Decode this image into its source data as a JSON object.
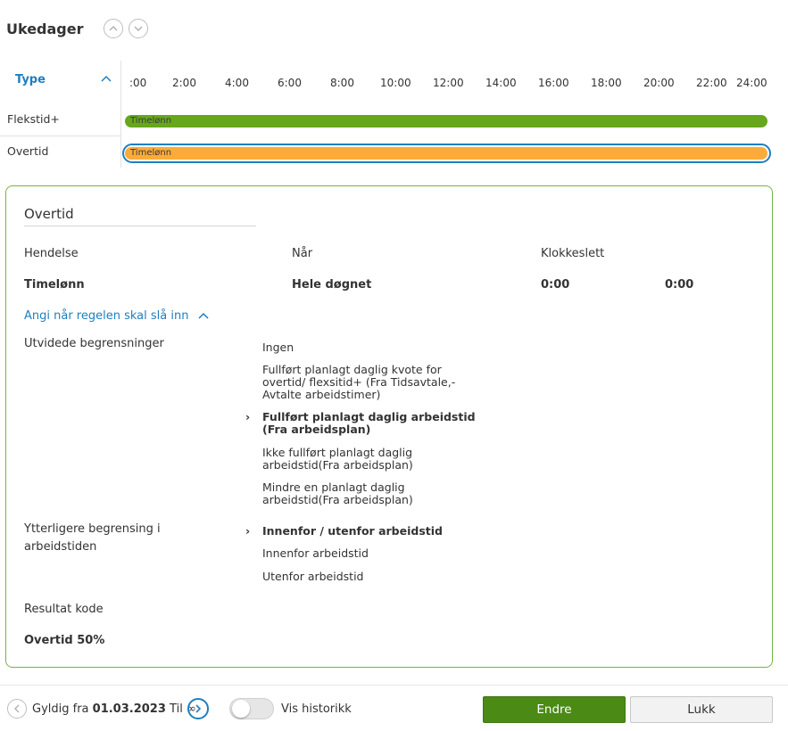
{
  "header": {
    "title": "Ukedager",
    "up_icon": "chevron-up-icon",
    "down_icon": "chevron-down-icon"
  },
  "timeline": {
    "type_label": "Type",
    "ticks": [
      ":00",
      "2:00",
      "4:00",
      "6:00",
      "8:00",
      "10:00",
      "12:00",
      "14:00",
      "16:00",
      "18:00",
      "20:00",
      "22:00",
      "24:00"
    ],
    "rows": [
      {
        "label": "Flekstid+",
        "bar_label": "Timelønn",
        "color": "#66a71c"
      },
      {
        "label": "Overtid",
        "bar_label": "Timelønn",
        "color": "#fbab3a"
      }
    ]
  },
  "detail": {
    "title": "Overtid",
    "headers": {
      "event": "Hendelse",
      "when": "Når",
      "time": "Klokkeslett"
    },
    "values": {
      "event": "Timelønn",
      "when": "Hele døgnet",
      "time_from": "0:00",
      "time_to": "0:00"
    },
    "rule_link": "Angi når regelen skal slå inn",
    "extended_label": "Utvidede begrensninger",
    "extended_options": [
      "Ingen",
      "Fullført planlagt daglig kvote for overtid/ flexsitid+ (Fra Tidsavtale,- Avtalte arbeidstimer)",
      "Fullført planlagt daglig arbeidstid (Fra arbeidsplan)",
      "Ikke fullført planlagt daglig arbeidstid(Fra arbeidsplan)",
      "Mindre en planlagt daglig arbeidstid(Fra arbeidsplan)"
    ],
    "extended_selected_index": 2,
    "further_label": "Ytterligere begrensing i arbeidstiden",
    "further_options": [
      "Innenfor / utenfor arbeidstid",
      "Innenfor arbeidstid",
      "Utenfor arbeidstid"
    ],
    "further_selected_index": 0,
    "result_label": "Resultat kode",
    "result_value": "Overtid 50%"
  },
  "footer": {
    "valid_prefix": "Gyldig fra",
    "valid_date": "01.03.2023",
    "valid_suffix": "Til ∞",
    "history_label": "Vis historikk",
    "history_enabled": false,
    "edit_button": "Endre",
    "close_button": "Lukk"
  }
}
